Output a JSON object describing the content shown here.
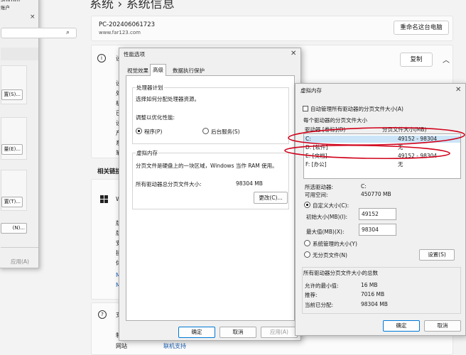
{
  "background": {
    "title": "系统 › 系统信息",
    "pc_name": "PC-202406061723",
    "pc_site": "www.far123.com",
    "rename_button": "重命名这台电脑",
    "copy_button": "复制",
    "related_label": "相关链接",
    "site_label": "网站",
    "site_link": "联机支持",
    "spec_fragments": [
      "设",
      "设",
      "处",
      "机",
      "已",
      "设",
      "产",
      "系",
      "笔"
    ],
    "related_fragments": [
      "W",
      "版",
      "版",
      "安",
      "操",
      "体",
      "M",
      "M"
    ],
    "support_fragments": [
      "支",
      "制"
    ]
  },
  "left_dialog": {
    "frag_title": "shimm",
    "frag_sub": "账户",
    "close": "×",
    "btn_settings": "置(S)...",
    "btn_env": "量(E)...",
    "btn_more": "置(T)...",
    "btn_n": "(N)...",
    "apply": "应用(A)"
  },
  "perf_dialog": {
    "title": "性能选项",
    "close": "✕",
    "tabs": [
      "视觉效果",
      "高级",
      "数据执行保护"
    ],
    "proc_group": "处理器计划",
    "proc_desc": "选择如何分配处理器资源。",
    "optimize_label": "调整以优化性能:",
    "radio_programs": "程序(P)",
    "radio_services": "后台服务(S)",
    "vm_group": "虚拟内存",
    "vm_desc": "分页文件是硬盘上的一块区域，Windows 当作 RAM 使用。",
    "vm_total_label": "所有驱动器总分页文件大小:",
    "vm_total_value": "98304 MB",
    "change_button": "更改(C)...",
    "ok": "确定",
    "cancel": "取消",
    "apply": "应用(A)"
  },
  "vm_dialog": {
    "title": "虚拟内存",
    "close": "✕",
    "auto_manage": "自动管理所有驱动器的分页文件大小(A)",
    "group_title": "每个驱动器的分页文件大小",
    "col_drive": "驱动器 [卷标](D)",
    "col_size": "分页文件大小(MB)",
    "drives": [
      {
        "drive": "C:",
        "size": "49152 - 98304"
      },
      {
        "drive": "D:     [软件]",
        "size": "无"
      },
      {
        "drive": "E:     [文档]",
        "size": "49152 - 98304"
      },
      {
        "drive": "F:     [办公]",
        "size": "无"
      }
    ],
    "sel_drive_label": "所选驱动器:",
    "sel_drive_value": "C:",
    "space_label": "可用空间:",
    "space_value": "450770 MB",
    "custom_size": "自定义大小(C):",
    "initial_label": "初始大小(MB)(I):",
    "initial_value": "49152",
    "max_label": "最大值(MB)(X):",
    "max_value": "98304",
    "system_managed": "系统管理的大小(Y)",
    "no_paging": "无分页文件(N)",
    "set_button": "设置(S)",
    "total_group": "所有驱动器分页文件大小的总数",
    "min_label": "允许的最小值:",
    "min_value": "16 MB",
    "rec_label": "推荐:",
    "rec_value": "7016 MB",
    "cur_label": "当前已分配:",
    "cur_value": "98304 MB",
    "ok": "确定",
    "cancel": "取消"
  },
  "colors": {
    "annotation": "#d0021b",
    "selection": "#cce4f7",
    "accent": "#0078d4"
  }
}
